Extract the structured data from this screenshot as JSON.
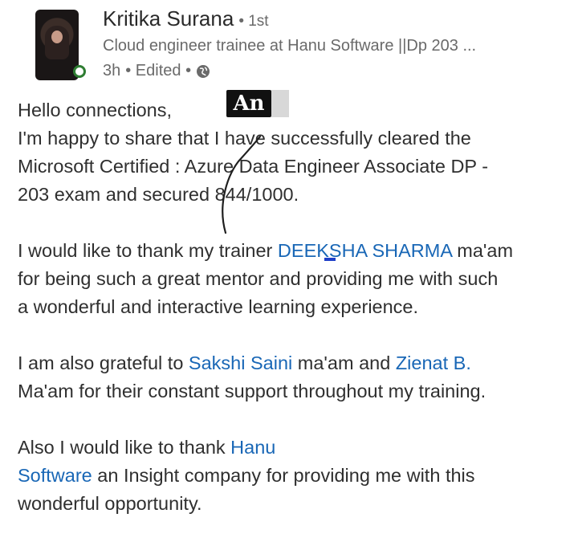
{
  "author": {
    "name": "Kritika Surana",
    "connection": "• 1st",
    "headline": "Cloud engineer trainee at Hanu Software ||Dp 203 ...",
    "time": "3h",
    "edited": "• Edited •",
    "visibility_icon": "globe-icon"
  },
  "watermark": {
    "text": "An"
  },
  "post": {
    "para1": {
      "line1": "Hello connections,",
      "line2": "I'm happy to share that I have successfully cleared the",
      "line3": "Microsoft Certified : Azure Data Engineer Associate DP -",
      "line4": "203 exam and secured 844/1000."
    },
    "para2": {
      "line1_prefix": "I would like to thank my trainer ",
      "line1_mention": "DEEKSHA SHARMA",
      "line1_suffix": " ma'am",
      "line2": "for being such a great mentor and providing me with such",
      "line3": "a wonderful and interactive learning experience."
    },
    "para3": {
      "line1_prefix": "I am also grateful  to ",
      "mention1": "Sakshi Saini",
      "line1_middle": " ma'am and ",
      "mention2": "Zienat B.",
      "line2": "Ma'am for their constant support throughout my training."
    },
    "para4": {
      "line1_prefix": "Also I would like to thank ",
      "mention_part1": "Hanu",
      "mention_part2": "Software",
      "line2_suffix": " an Insight company for providing me with this",
      "line3": "wonderful opportunity."
    }
  },
  "colors": {
    "mention": "#1967b6",
    "online_status": "#2e7d32",
    "text": "#2f2f2f",
    "muted": "#6a6a6a"
  }
}
